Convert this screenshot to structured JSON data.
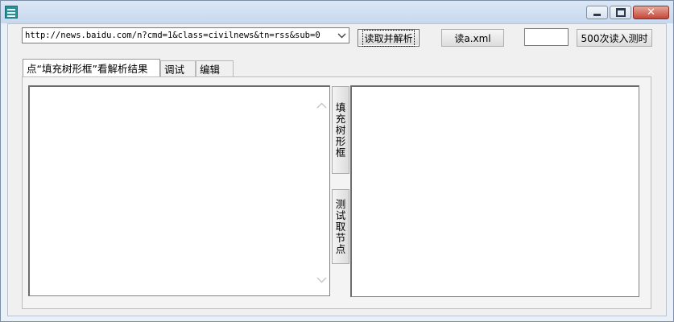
{
  "toolbar": {
    "url_value": "http://news.baidu.com/n?cmd=1&class=civilnews&tn=rss&sub=0",
    "read_parse_label": "读取并解析",
    "read_xml_label": "读a.xml",
    "count_value": "",
    "read500_label": "500次读入测时"
  },
  "tabs": [
    {
      "label": "点“填充树形框”看解析结果"
    },
    {
      "label": "调试"
    },
    {
      "label": "编辑"
    }
  ],
  "side_buttons": {
    "fill_tree": [
      "填",
      "充",
      "树",
      "形",
      "框"
    ],
    "test_node": [
      "测",
      "试",
      "取",
      "节",
      "点"
    ]
  },
  "icons": {
    "app": "app-icon",
    "minimize": "minimize-icon",
    "maximize": "maximize-icon",
    "close": "close-icon",
    "dropdown": "chevron-down-icon",
    "scroll_up": "chevron-up-icon",
    "scroll_down": "chevron-down-icon"
  }
}
